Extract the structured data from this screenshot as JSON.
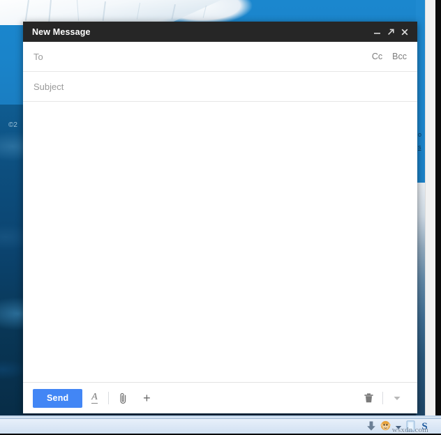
{
  "desktop": {
    "wallpaper_description": "iceberg-photo-wallpaper",
    "copyright_mark": "©2",
    "right_band_text_1": "o",
    "right_band_text_2": "s",
    "watermark": "wsxdn.com"
  },
  "taskbar": {
    "icons": [
      {
        "name": "download-arrow-icon",
        "label": "Downloads"
      },
      {
        "name": "monkey-face-icon",
        "label": "Monkey"
      },
      {
        "name": "chevron-down-icon",
        "label": "Show hidden icons"
      },
      {
        "name": "document-icon",
        "label": "Document"
      },
      {
        "name": "skype-icon",
        "label": "S"
      }
    ]
  },
  "compose": {
    "title": "New Message",
    "window_controls": [
      {
        "name": "minimize-button",
        "glyph": "–",
        "label": "Minimize"
      },
      {
        "name": "popout-button",
        "glyph": "↗",
        "label": "Full screen"
      },
      {
        "name": "close-button",
        "glyph": "✕",
        "label": "Close"
      }
    ],
    "to_field": {
      "placeholder": "To",
      "value": ""
    },
    "cc_label": "Cc",
    "bcc_label": "Bcc",
    "subject_field": {
      "placeholder": "Subject",
      "value": ""
    },
    "body_field": {
      "placeholder": "",
      "value": ""
    },
    "toolbar": {
      "send_label": "Send",
      "format_label": "A",
      "plus_label": "+",
      "buttons": [
        {
          "name": "send-button",
          "label": "Send"
        },
        {
          "name": "formatting-options-icon",
          "label": "Formatting options"
        },
        {
          "name": "attach-file-icon",
          "label": "Attach files"
        },
        {
          "name": "insert-more-icon",
          "label": "Insert more"
        },
        {
          "name": "discard-draft-icon",
          "label": "Discard draft"
        },
        {
          "name": "more-options-icon",
          "label": "More options"
        }
      ]
    }
  }
}
